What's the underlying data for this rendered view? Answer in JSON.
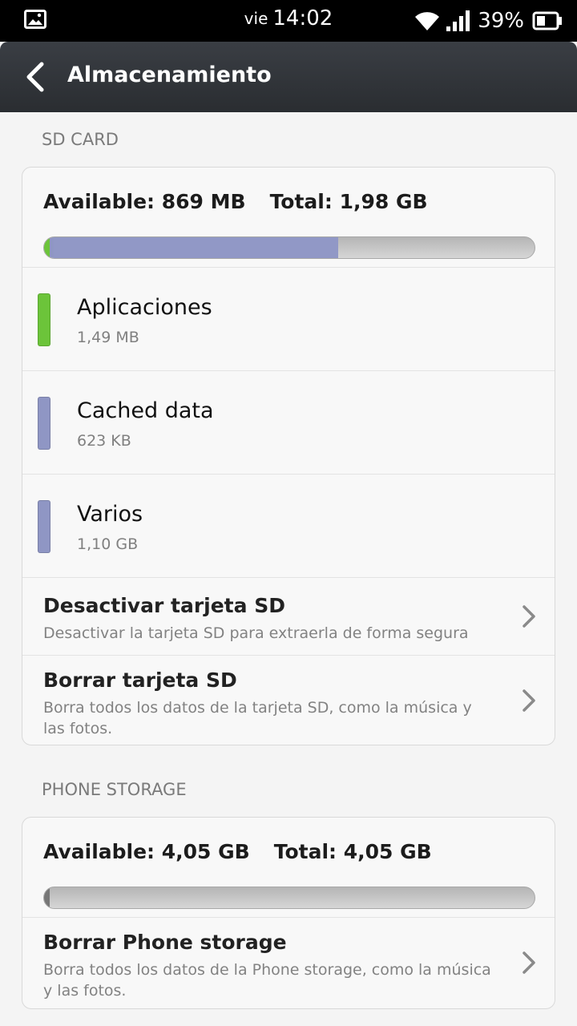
{
  "status_bar": {
    "day": "vie",
    "time": "14:02",
    "battery": "39%"
  },
  "title_bar": {
    "title": "Almacenamiento"
  },
  "sd_card": {
    "header": "SD CARD",
    "available_label": "Available: 869 MB",
    "total_label": "Total: 1,98 GB",
    "usage_bar": {
      "apps_fraction": 0.003,
      "cached_fraction": 0.002,
      "misc_fraction": 0.58
    },
    "categories": [
      {
        "name": "Aplicaciones",
        "size": "1,49 MB",
        "color": "#6cc43a"
      },
      {
        "name": "Cached data",
        "size": "623 KB",
        "color": "#8f96c4"
      },
      {
        "name": "Varios",
        "size": "1,10 GB",
        "color": "#8f96c4"
      }
    ],
    "actions": [
      {
        "title": "Desactivar tarjeta SD",
        "description": "Desactivar la tarjeta SD para extraerla de forma segura"
      },
      {
        "title": "Borrar tarjeta SD",
        "description": "Borra todos los datos de la tarjeta SD, como la música y las fotos."
      }
    ]
  },
  "phone_storage": {
    "header": "PHONE STORAGE",
    "available_label": "Available: 4,05 GB",
    "total_label": "Total: 4,05 GB",
    "usage_bar": {
      "used_fraction": 0.012
    },
    "actions": [
      {
        "title": "Borrar Phone storage",
        "description": "Borra todos los datos de la Phone storage, como la música y las fotos."
      }
    ]
  },
  "icons": {
    "status_left": "image-icon",
    "wifi": "wifi-icon",
    "signal": "signal-icon",
    "battery": "battery-icon",
    "back": "back-arrow-icon",
    "chevron": "chevron-right-icon"
  },
  "colors": {
    "bar_track": "#c4c4c4",
    "apps": "#6cc43a",
    "cached": "#8f96c4",
    "misc": "#9198c6",
    "phone_used": "#777777"
  }
}
